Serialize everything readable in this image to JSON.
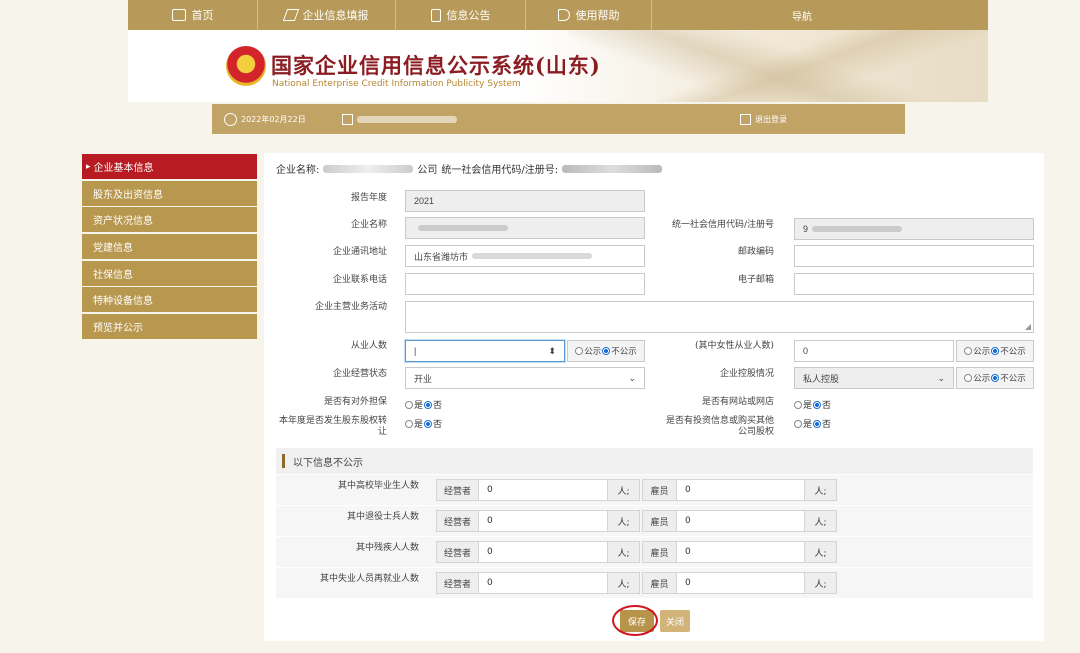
{
  "nav": {
    "items": [
      {
        "label": "首页",
        "icon": "monitor-icon"
      },
      {
        "label": "企业信息填报",
        "icon": "edit-icon"
      },
      {
        "label": "信息公告",
        "icon": "document-icon"
      },
      {
        "label": "使用帮助",
        "icon": "speaker-icon"
      },
      {
        "label": "导航",
        "icon": ""
      }
    ]
  },
  "banner": {
    "title_cn": "国家企业信用信息公示系统(山东)",
    "title_en": "National Enterprise Credit Information Publicity System"
  },
  "status": {
    "date": "2022年02月22日",
    "logout": "退出登录"
  },
  "sidebar": {
    "items": [
      {
        "label": "企业基本信息",
        "active": true
      },
      {
        "label": "股东及出资信息",
        "active": false
      },
      {
        "label": "资产状况信息",
        "active": false
      },
      {
        "label": "党建信息",
        "active": false
      },
      {
        "label": "社保信息",
        "active": false
      },
      {
        "label": "特种设备信息",
        "active": false
      },
      {
        "label": "预览并公示",
        "active": false
      }
    ]
  },
  "form": {
    "enterprise_label": "企业名称:",
    "enterprise_suffix": "公司",
    "uscc_label": "统一社会信用代码/注册号:",
    "report_year_label": "报告年度",
    "report_year_value": "2021",
    "name_label": "企业名称",
    "uscc_field_label": "统一社会信用代码/注册号",
    "uscc_value_prefix": "9",
    "address_label": "企业通讯地址",
    "address_value_prefix": "山东省潍坊市",
    "postcode_label": "邮政编码",
    "phone_label": "企业联系电话",
    "email_label": "电子邮箱",
    "business_label": "企业主营业务活动",
    "employees_label": "从业人数",
    "employees_value": "|",
    "public_option": "公示",
    "nonpublic_option": "不公示",
    "female_label": "(其中女性从业人数)",
    "female_value": "0",
    "status_label": "企业经营状态",
    "status_value": "开业",
    "holding_label": "企业控股情况",
    "holding_value": "私人控股",
    "guarantee_label": "是否有对外担保",
    "website_label": "是否有网站或网店",
    "transfer_label": "本年度是否发生股东股权转让",
    "invest_label": "是否有投资信息或购买其他公司股权",
    "yes": "是",
    "no": "否"
  },
  "section": {
    "title": "以下信息不公示",
    "operator_label": "经营者",
    "employee_label": "雇员",
    "unit": "人;",
    "rows": [
      {
        "label": "其中高校毕业生人数",
        "operator": "0",
        "employee": "0"
      },
      {
        "label": "其中退役士兵人数",
        "operator": "0",
        "employee": "0"
      },
      {
        "label": "其中残疾人人数",
        "operator": "0",
        "employee": "0"
      },
      {
        "label": "其中失业人员再就业人数",
        "operator": "0",
        "employee": "0"
      }
    ]
  },
  "buttons": {
    "save": "保存",
    "close": "关闭"
  },
  "colors": {
    "nav_gold": "#b79a5a",
    "active_red": "#b81c22",
    "highlight_circle": "#d2131d"
  }
}
